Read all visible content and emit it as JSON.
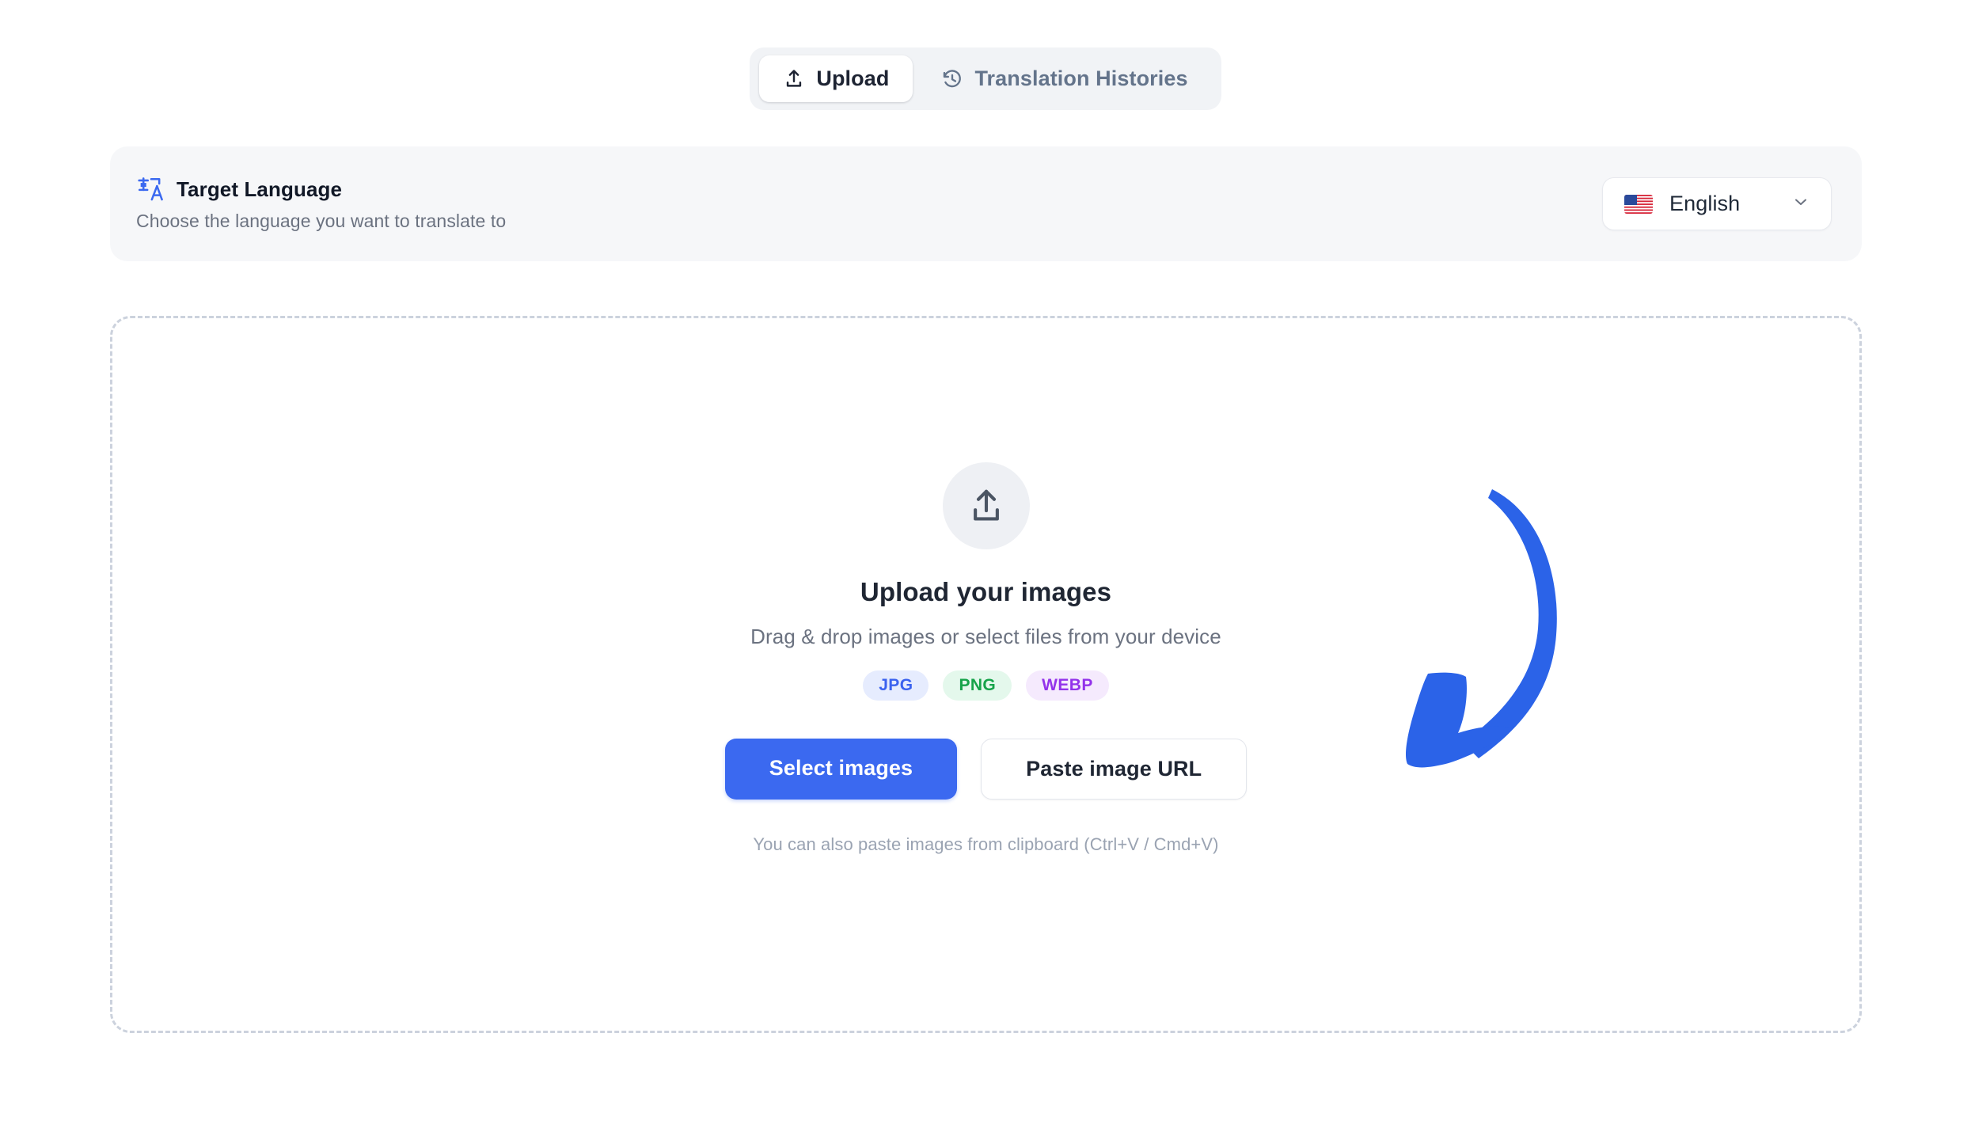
{
  "tabs": [
    {
      "id": "upload",
      "label": "Upload",
      "icon": "upload-icon",
      "active": true
    },
    {
      "id": "histories",
      "label": "Translation Histories",
      "icon": "history-icon",
      "active": false
    }
  ],
  "target_language": {
    "icon": "translate-icon",
    "title": "Target Language",
    "subtitle": "Choose the language you want to translate to",
    "selector": {
      "flag": "🇺🇸",
      "value": "English",
      "chevron": "chevron-down-icon"
    }
  },
  "dropzone": {
    "icon": "upload-cloud-icon",
    "title": "Upload your images",
    "subtitle": "Drag & drop images or select files from your device",
    "formats": [
      {
        "label": "JPG",
        "color": "#3b62ef",
        "background": "#e6ecfe"
      },
      {
        "label": "PNG",
        "color": "#16a34a",
        "background": "#e4f8ec"
      },
      {
        "label": "WEBP",
        "color": "#9333ea",
        "background": "#f5eafd"
      }
    ],
    "primary_button": "Select images",
    "secondary_button": "Paste image URL",
    "hint": "You can also paste images from clipboard (Ctrl+V / Cmd+V)"
  },
  "annotation": {
    "name": "curved-arrow-annotation",
    "color": "#2b63e8"
  },
  "colors": {
    "accent": "#3b69f0",
    "page_background": "#ffffff",
    "card_background": "#f6f7f9",
    "tabbar_background": "#f1f3f6",
    "muted_text": "#6b7280",
    "dashed_border": "#ccd2dd"
  }
}
